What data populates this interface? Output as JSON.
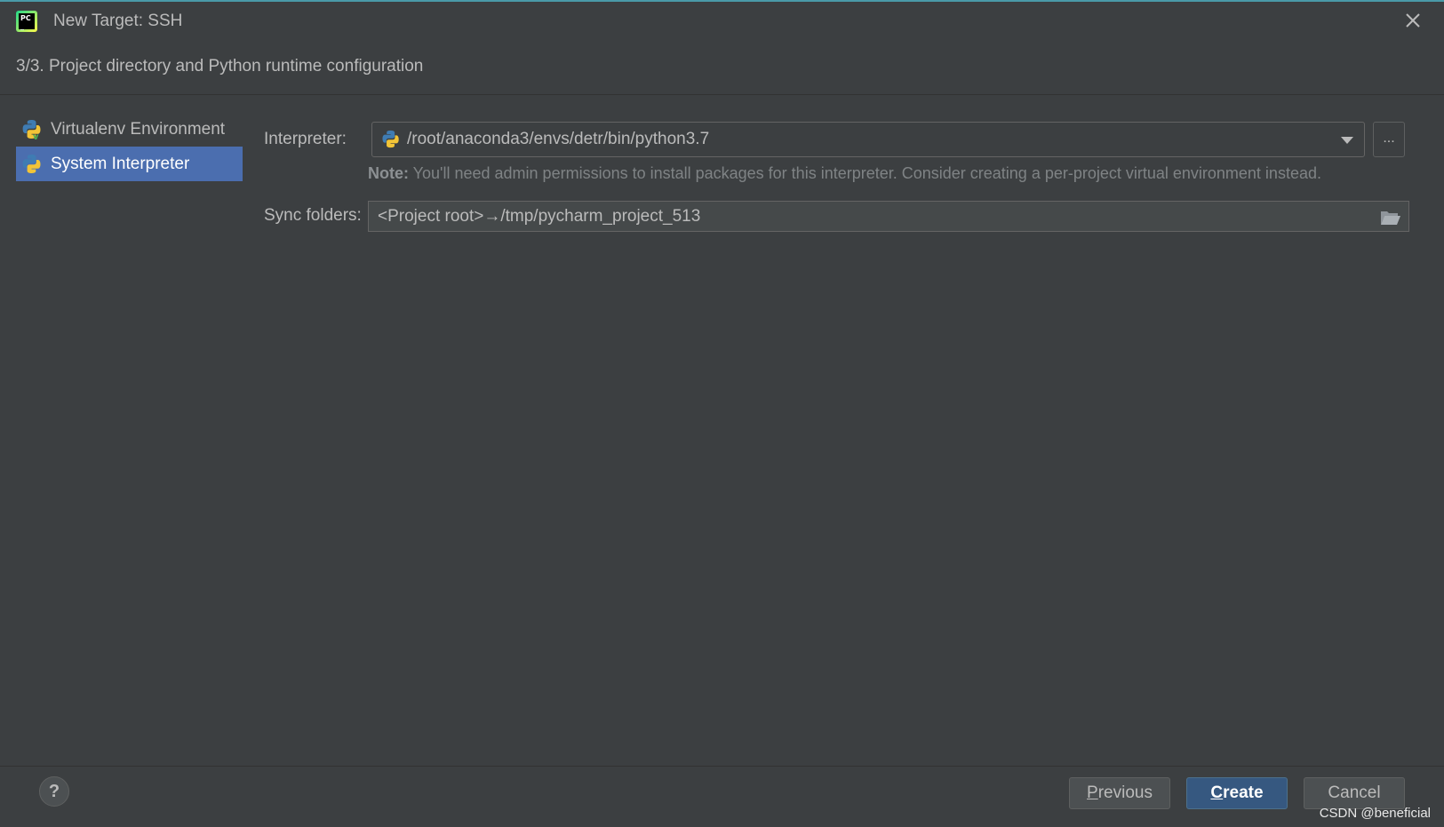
{
  "window": {
    "title": "New Target: SSH",
    "step_title": "3/3. Project directory and Python runtime configuration"
  },
  "env_types": [
    {
      "label": "Virtualenv Environment",
      "icon": "python-virtualenv-icon",
      "selected": false
    },
    {
      "label": "System Interpreter",
      "icon": "python-icon",
      "selected": true
    }
  ],
  "form": {
    "interpreter_label": "Interpreter:",
    "interpreter_value": "/root/anaconda3/envs/detr/bin/python3.7",
    "browse_label": "...",
    "note_bold": "Note:",
    "note_text": " You'll need admin permissions to install packages for this interpreter. Consider creating a per-project virtual environment instead.",
    "sync_label": "Sync folders:",
    "sync_value": "<Project root>→/tmp/pycharm_project_513"
  },
  "footer": {
    "help_label": "?",
    "previous_mnemonic": "P",
    "previous_rest": "revious",
    "create_mnemonic": "C",
    "create_rest": "reate",
    "cancel_label": "Cancel"
  },
  "watermark": "CSDN @beneficial",
  "colors": {
    "background": "#3c3f41",
    "selection": "#4b6eaf",
    "primary_button": "#365880",
    "accent_border": "#4a9aa8"
  }
}
